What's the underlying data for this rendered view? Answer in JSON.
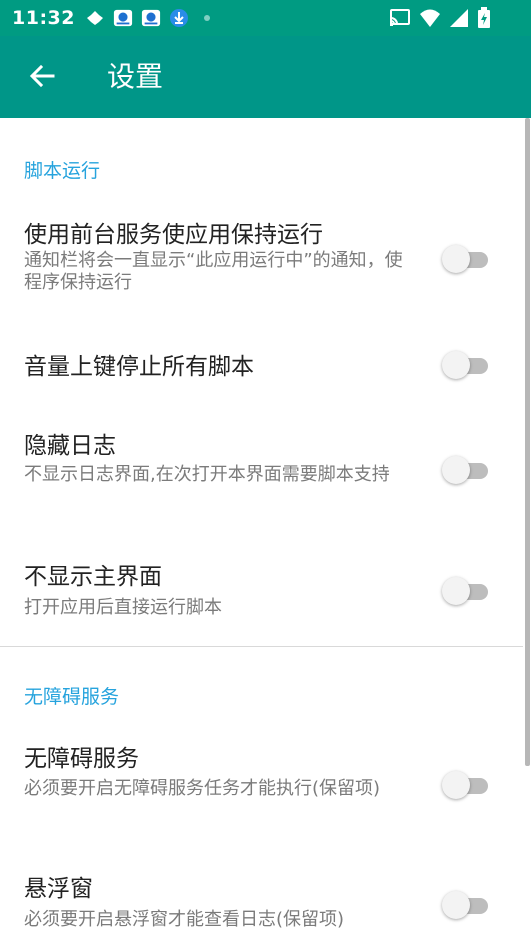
{
  "status_bar": {
    "time": "11:32",
    "left_icons": [
      "pinwheel-notification-icon",
      "app-notification-icon",
      "app-notification-icon",
      "download-notification-icon",
      "dot-icon"
    ],
    "right_icons": [
      "cast-icon",
      "wifi-icon",
      "signal-icon",
      "battery-charging-icon"
    ]
  },
  "toolbar": {
    "title": "设置",
    "back_icon": "arrow-back-icon",
    "color": "#009688"
  },
  "sections": [
    {
      "header": "脚本运行",
      "items": [
        {
          "title": "使用前台服务使应用保持运行",
          "summary": "通知栏将会一直显示“此应用运行中”的通知，使程序保持运行",
          "enabled": false
        },
        {
          "title": "音量上键停止所有脚本",
          "summary": "",
          "enabled": false
        },
        {
          "title": "隐藏日志",
          "summary": "不显示日志界面,在次打开本界面需要脚本支持",
          "enabled": false
        },
        {
          "title": "不显示主界面",
          "summary": "打开应用后直接运行脚本",
          "enabled": false
        }
      ]
    },
    {
      "header": "无障碍服务",
      "items": [
        {
          "title": "无障碍服务",
          "summary": "必须要开启无障碍服务任务才能执行(保留项)",
          "enabled": false
        },
        {
          "title": "悬浮窗",
          "summary": "必须要开启悬浮窗才能查看日志(保留项)",
          "enabled": false
        }
      ]
    }
  ],
  "colors": {
    "accent": "#26a3dd",
    "status_bar": "#009b82",
    "switch_off_track": "#bdbdbd"
  }
}
